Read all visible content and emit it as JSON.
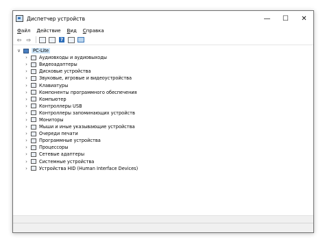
{
  "window": {
    "title": "Диспетчер устройств",
    "controls": {
      "minimize": "—",
      "maximize": "☐",
      "close": "✕"
    }
  },
  "menu": [
    {
      "ul": "Ф",
      "rest": "айл"
    },
    {
      "ul": "Д",
      "rest": "ействие"
    },
    {
      "ul": "В",
      "rest": "ид"
    },
    {
      "ul": "С",
      "rest": "правка"
    }
  ],
  "toolbar": {
    "back_icon": "⇦",
    "forward_icon": "⇨",
    "help_label": "?"
  },
  "tree": {
    "root": {
      "label": "PC-Lite",
      "toggle": "∨"
    },
    "collapsed_toggle": "›",
    "items": [
      "Аудиовходы и аудиовыходы",
      "Видеоадаптеры",
      "Дисковые устройства",
      "Звуковые, игровые и видеоустройства",
      "Клавиатуры",
      "Компоненты программного обеспечения",
      "Компьютер",
      "Контроллеры USB",
      "Контроллеры запоминающих устройств",
      "Мониторы",
      "Мыши и иные указывающие устройства",
      "Очереди печати",
      "Программные устройства",
      "Процессоры",
      "Сетевые адаптеры",
      "Системные устройства",
      "Устройства HID (Human Interface Devices)"
    ]
  }
}
